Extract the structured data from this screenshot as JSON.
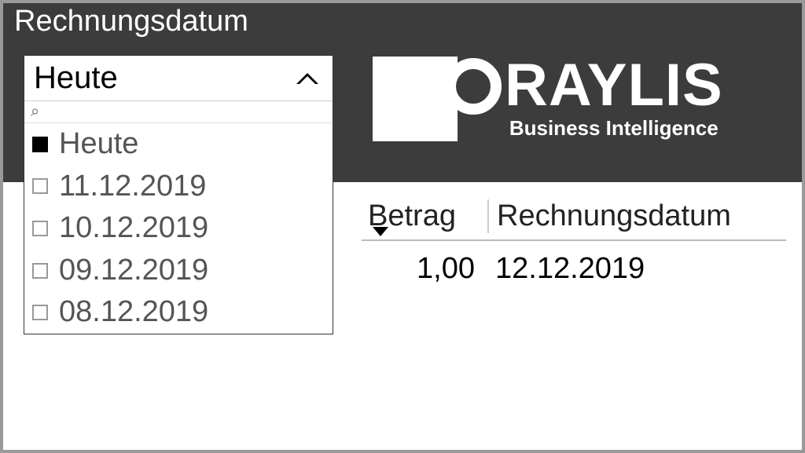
{
  "slicer": {
    "title": "Rechnungsdatum",
    "selected": "Heute",
    "search_placeholder": "",
    "options": [
      {
        "label": "Heute",
        "checked": true
      },
      {
        "label": "11.12.2019",
        "checked": false
      },
      {
        "label": "10.12.2019",
        "checked": false
      },
      {
        "label": "09.12.2019",
        "checked": false
      },
      {
        "label": "08.12.2019",
        "checked": false
      }
    ]
  },
  "logo": {
    "name": "RAYLIS",
    "subtitle": "Business Intelligence"
  },
  "table": {
    "columns": {
      "betrag": "Betrag",
      "datum": "Rechnungsdatum"
    },
    "rows": [
      {
        "betrag": "1,00",
        "datum": "12.12.2019"
      }
    ]
  }
}
